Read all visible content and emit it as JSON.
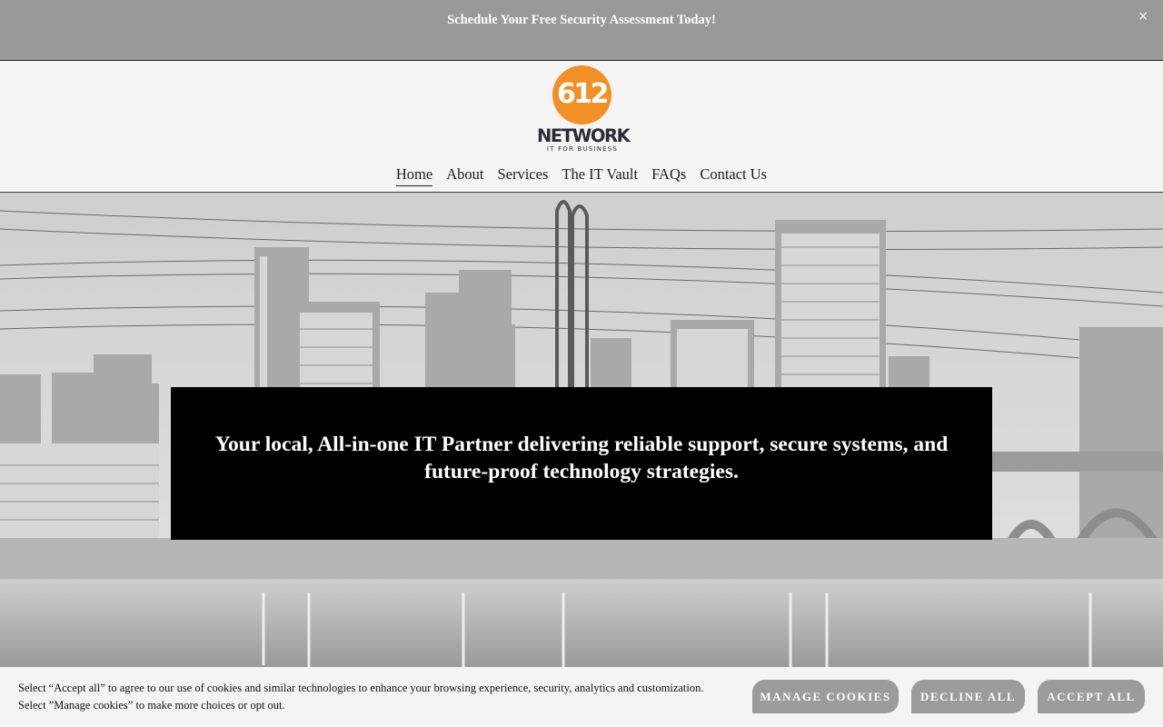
{
  "announcement": {
    "text": "Schedule Your Free Security Assessment Today!",
    "close": "×"
  },
  "logo": {
    "number": "612",
    "name": "NETWORK",
    "tagline": "IT FOR BUSINESS",
    "accent_color": "#f19027"
  },
  "nav": {
    "items": [
      {
        "label": "Home",
        "active": true
      },
      {
        "label": "About"
      },
      {
        "label": "Services"
      },
      {
        "label": "The IT Vault"
      },
      {
        "label": "FAQs"
      },
      {
        "label": "Contact Us"
      }
    ]
  },
  "hero": {
    "background": "grayscale city skyline with bridge and river",
    "headline": "Your local, All-in-one IT Partner delivering reliable support, secure systems, and future-proof technology strategies."
  },
  "cookie_banner": {
    "line1": "Select “Accept all” to agree to our use of cookies and similar technologies to enhance your browsing experience, security, analytics and customization.",
    "line2": "Select ”Manage cookies” to make more choices or opt out.",
    "manage": "MANAGE COOKIES",
    "decline": "DECLINE ALL",
    "accept": "ACCEPT ALL"
  }
}
